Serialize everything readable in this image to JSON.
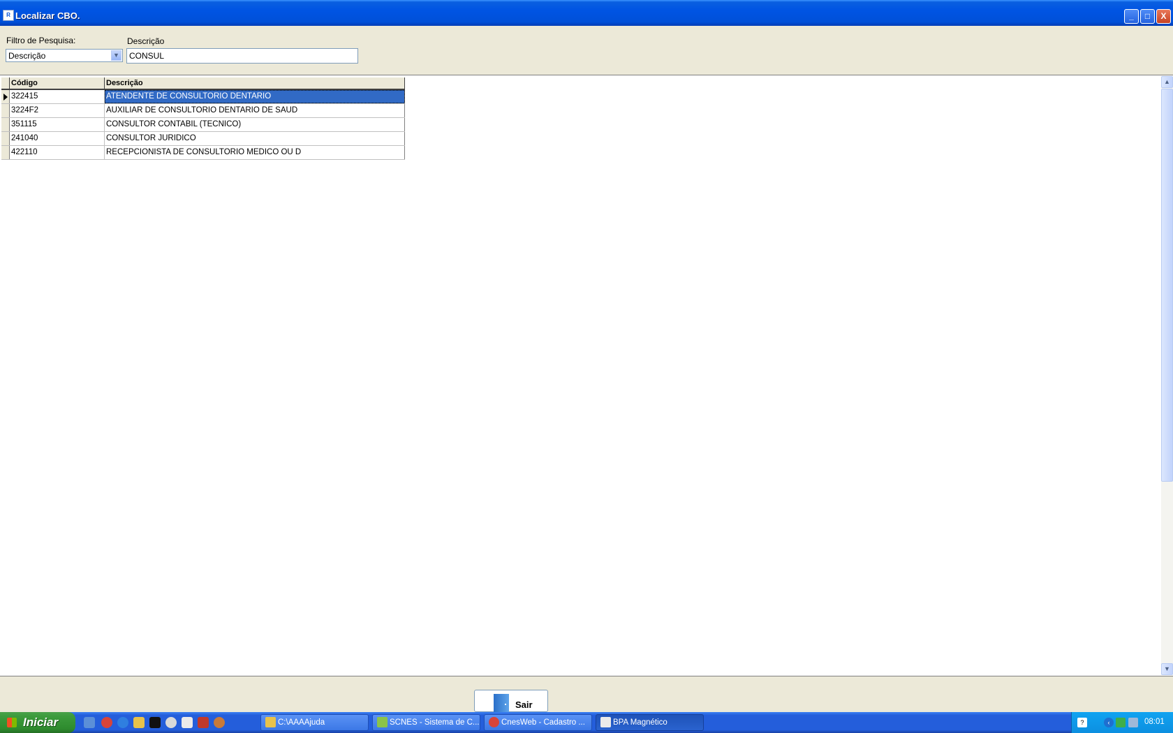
{
  "window": {
    "title": "Localizar CBO.",
    "icon": "app-icon",
    "controls": {
      "minimize": "_",
      "maximize": "□",
      "close": "X"
    }
  },
  "filter": {
    "filter_label": "Filtro de Pesquisa:",
    "filter_selected": "Descrição",
    "description_label": "Descrição",
    "description_value": "CONSUL"
  },
  "grid": {
    "columns": [
      "Código",
      "Descrição"
    ],
    "rows": [
      {
        "code": "322415",
        "description": "ATENDENTE DE CONSULTORIO DENTARIO",
        "selected": true
      },
      {
        "code": "3224F2",
        "description": "AUXILIAR DE CONSULTORIO DENTARIO DE SAUD",
        "selected": false
      },
      {
        "code": "351115",
        "description": "CONSULTOR CONTABIL (TECNICO)",
        "selected": false
      },
      {
        "code": "241040",
        "description": "CONSULTOR JURIDICO",
        "selected": false
      },
      {
        "code": "422110",
        "description": "RECEPCIONISTA DE CONSULTORIO MEDICO OU D",
        "selected": false
      }
    ]
  },
  "actions": {
    "exit_label": "Sair"
  },
  "taskbar": {
    "start_label": "Iniciar",
    "buttons": [
      {
        "label": "C:\\AAAAjuda",
        "icon": "folder-icon",
        "active": false
      },
      {
        "label": "SCNES - Sistema de C...",
        "icon": "scnes-icon",
        "active": false
      },
      {
        "label": "CnesWeb - Cadastro ...",
        "icon": "chrome-icon",
        "active": false
      },
      {
        "label": "BPA Magnético",
        "icon": "bpa-icon",
        "active": true
      }
    ],
    "clock": "08:01"
  },
  "colors": {
    "selection": "#316ac5",
    "titlebar": "#0054e3",
    "window_bg": "#ece9d8"
  }
}
